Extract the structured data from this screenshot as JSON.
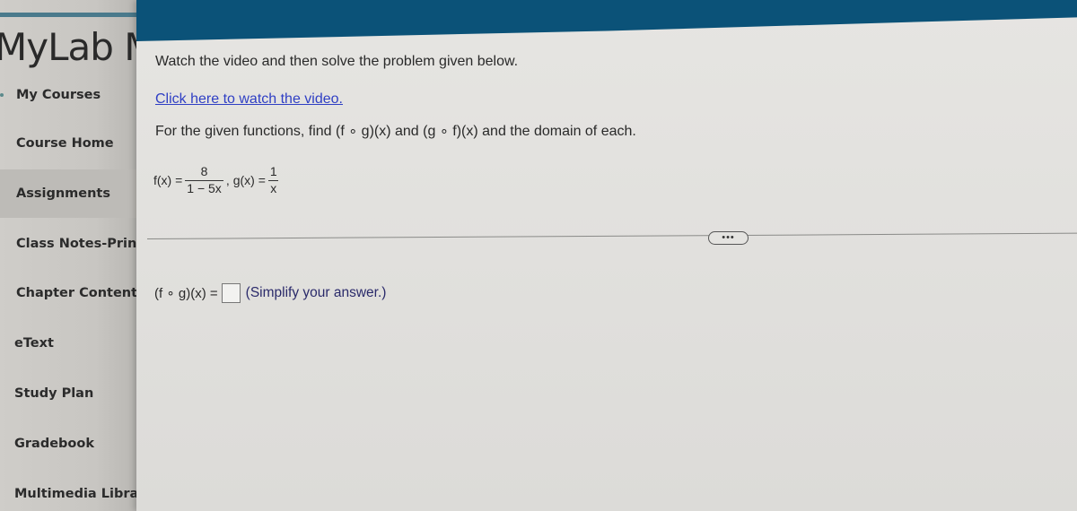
{
  "sidebar": {
    "brand": "MyLab M",
    "items": [
      {
        "label": "My Courses",
        "active": false
      },
      {
        "label": "Course Home",
        "active": false
      },
      {
        "label": "Assignments",
        "active": true
      },
      {
        "label": "Class Notes-Print",
        "active": false
      },
      {
        "label": "Chapter Contents",
        "active": false
      },
      {
        "label": "eText",
        "active": false
      },
      {
        "label": "Study Plan",
        "active": false
      },
      {
        "label": "Gradebook",
        "active": false
      },
      {
        "label": "Multimedia Library",
        "active": false
      }
    ]
  },
  "header": {
    "color": "#0b5278"
  },
  "problem": {
    "instruction": "Watch the video and then solve the problem given below.",
    "video_link": "Click here to watch the video.",
    "question": "For the given functions, find (f ∘ g)(x) and (g ∘ f)(x) and the domain of each.",
    "f_label": "f(x) =",
    "f_numerator": "8",
    "f_denominator": "1 − 5x",
    "separator": ",",
    "g_label": "g(x) =",
    "g_numerator": "1",
    "g_denominator": "x",
    "more_button": "•••",
    "answer_label": "(f ∘ g)(x) =",
    "answer_value": "",
    "answer_hint": "(Simplify your answer.)"
  }
}
